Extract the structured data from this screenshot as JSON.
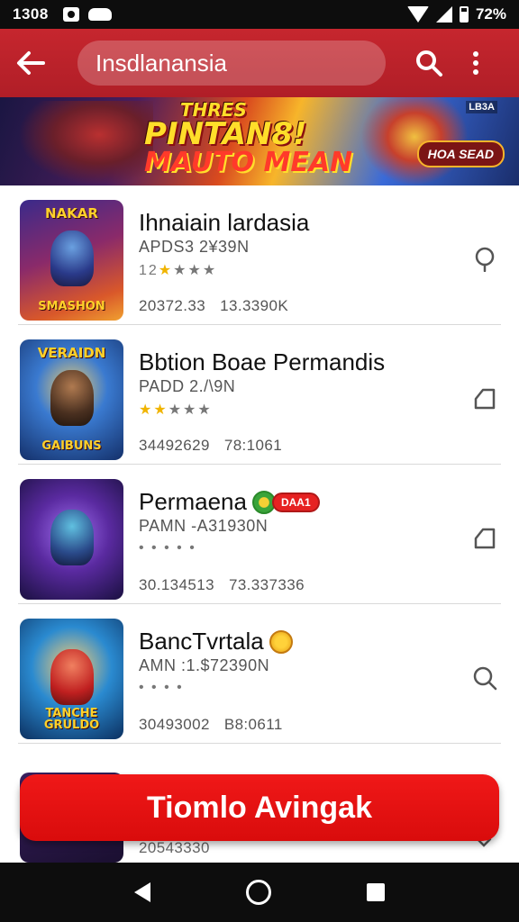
{
  "status_bar": {
    "time": "1308",
    "battery": "72%",
    "icons": [
      "notification-icon",
      "cloud-icon",
      "wifi-icon",
      "signal-icon",
      "battery-icon"
    ]
  },
  "app_bar": {
    "search_text": "Insdlanansia",
    "icons": [
      "back-arrow-icon",
      "search-icon",
      "more-vert-icon"
    ],
    "color": "#c6262e"
  },
  "banner": {
    "line1": "THRES",
    "line2": "PINTAN8!",
    "line3": "MAUTO MEAN",
    "tag": "LB3A",
    "button": "HOA SEAD"
  },
  "apps": [
    {
      "title": "Ihnaiain lardasia",
      "subtitle": "APDS3 2¥39N",
      "rating_text": "12",
      "stars_filled": 1,
      "stars_total": 4,
      "stat1": "20372.33",
      "stat2": "13.3390K",
      "icon_top": "NAKAR",
      "icon_caption": "SMASHON",
      "action_icon": "pin-icon"
    },
    {
      "title": "Bbtion Boae Permandis",
      "subtitle": "PADD 2./\\9N",
      "rating_text": "",
      "stars_filled": 2,
      "stars_total": 5,
      "stat1": "34492629",
      "stat2": "78:1061",
      "icon_top": "VERAIDN",
      "icon_caption": "GAIBUNS",
      "action_icon": "bookmark-icon"
    },
    {
      "title": "Permaena",
      "subtitle": "PAMN -A31930N",
      "rating_text": "• • • • •",
      "stars_filled": 0,
      "stars_total": 0,
      "stat1": "30.134513",
      "stat2": "73.337336",
      "icon_top": "",
      "icon_caption": "",
      "badge_tag": "DAA1",
      "action_icon": "bookmark-icon"
    },
    {
      "title": "BancTvrtala",
      "subtitle": "AMN :1.$72390N",
      "rating_text": "• • • •",
      "stars_filled": 0,
      "stars_total": 0,
      "stat1": "30493002",
      "stat2": "B8:0611",
      "icon_top": "",
      "icon_caption": "TANCHE GRULDO",
      "action_icon": "search-icon"
    }
  ],
  "peek_row": {
    "stat1": "20543330"
  },
  "cta": {
    "label": "Tiomlo Avingak"
  }
}
